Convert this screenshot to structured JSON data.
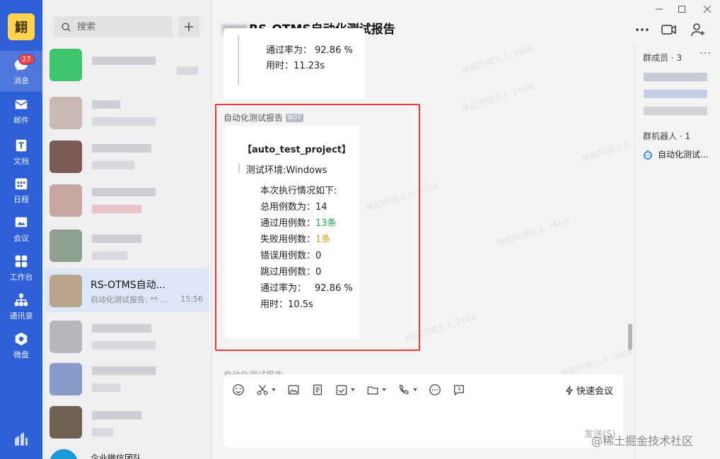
{
  "app": {
    "logo_char": "鮙",
    "nav": [
      {
        "label": "消息",
        "icon": "chat-bubble-icon",
        "badge": "27",
        "active": true
      },
      {
        "label": "邮件",
        "icon": "mail-icon"
      },
      {
        "label": "文档",
        "icon": "document-icon"
      },
      {
        "label": "日程",
        "icon": "calendar-icon"
      },
      {
        "label": "会议",
        "icon": "meeting-icon"
      },
      {
        "label": "工作台",
        "icon": "workbench-icon"
      },
      {
        "label": "通讯录",
        "icon": "contacts-icon"
      },
      {
        "label": "微盘",
        "icon": "cloud-drive-icon"
      }
    ]
  },
  "list": {
    "search_placeholder": "搜索",
    "active_conversation": {
      "title": "RS-OTMS自动...",
      "preview": "自动化测试报告: ** ...",
      "time": "15:56"
    },
    "bottom_partial": "企业微信团队"
  },
  "chat": {
    "title": "RS-OTMS自动化测试报告",
    "prev_card": {
      "pass_rate": "通过率为：  92.86 %",
      "duration": "用时：11.23s"
    },
    "sender": "自动化测试报告",
    "bot_tag": "BOT",
    "card": {
      "project": "【auto_test_project】",
      "env": "测试环境:Windows",
      "summary": "本次执行情况如下:",
      "total_label": "总用例数为：",
      "total": "14",
      "passed_label": "通过用例数：",
      "passed": "13条",
      "failed_label": "失败用例数：",
      "failed": "1条",
      "errors_label": "错误用例数：",
      "errors": "0",
      "skipped_label": "跳过用例数：",
      "skipped": "0",
      "pass_rate_label": "通过率为：",
      "pass_rate": "92.86 %",
      "duration_label": "用时：",
      "duration": "10.5s"
    },
    "next_sender": "自动化测试报告",
    "watermark": "缘起阿健主人 2668",
    "quick_meeting": "快速会议",
    "send_label": "发送(S)"
  },
  "side": {
    "members_label": "群成员 · 3",
    "robots_label": "群机器人 · 1",
    "robot_name": "自动化测试..."
  },
  "footer_watermark": "@稀土掘金技术社区",
  "colors": {
    "nav": "#2f5fd6",
    "badge": "#f04040",
    "highlight": "#e43a3a",
    "pass": "#1fae4a",
    "fail": "#e0a012"
  }
}
